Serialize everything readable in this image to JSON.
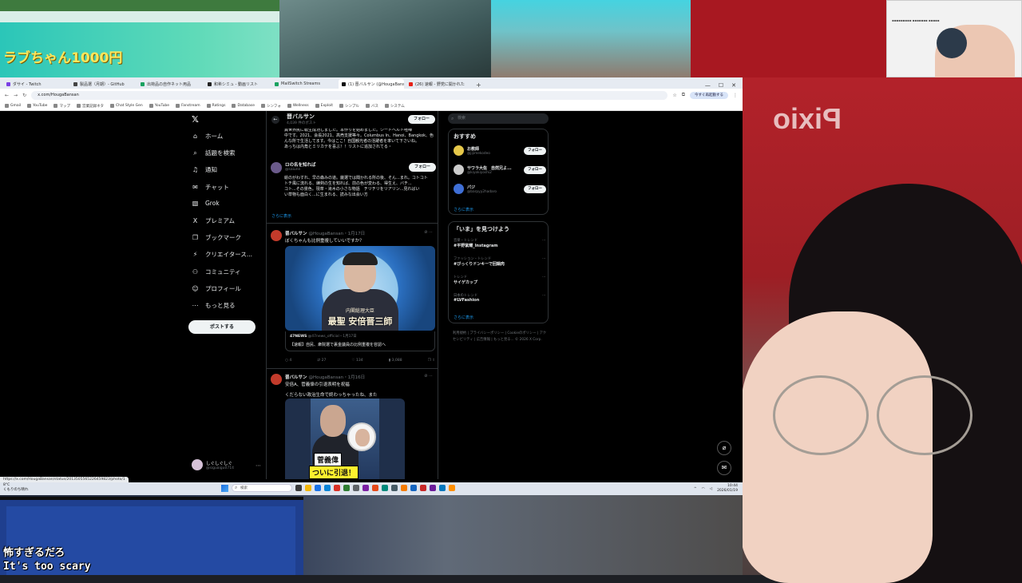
{
  "overlay": {
    "stream_title": "ラブちゃん1000円",
    "subtitle_jp": "怖すぎるだろ",
    "subtitle_en": "It's too scary",
    "backdrop_brand": "Pixio"
  },
  "browser": {
    "tabs": [
      {
        "label": "ダサイ - Twitch",
        "color": "#7b3fe4"
      },
      {
        "label": "製品選（月期）- GitHub",
        "color": "#444444"
      },
      {
        "label": "出荷品の自作ネット用品",
        "color": "#1aa260"
      },
      {
        "label": "和希シミュ - 動画リスト",
        "color": "#222222"
      },
      {
        "label": "MailSwitch Streams",
        "color": "#1aa260"
      },
      {
        "label": "(1) 晋バルサン (@HougaBansan)",
        "color": "#111111",
        "active": true
      },
      {
        "label": "(26) 速報 - 野党に開かれた",
        "color": "#e62117"
      }
    ],
    "url": "x.com/HougaBansan",
    "relaunch_label": "今すぐ再起動する",
    "bookmarks": [
      "Gmail",
      "YouTube",
      "マップ",
      "営業記録ネタ",
      "Chat Style Gen",
      "YouTube",
      "Fanstream",
      "Ratings",
      "Database",
      "シンフォ",
      "Wellness",
      "Exploit",
      "シンプル",
      "バス",
      "システム"
    ],
    "status_url": "https://x.com/HougaBansan/status/2013505565226459823/photo/1"
  },
  "nav": {
    "logo": "𝕏",
    "items": [
      {
        "icon": "⌂",
        "label": "ホーム"
      },
      {
        "icon": "⌕",
        "label": "話題を検索"
      },
      {
        "icon": "♫",
        "label": "通知"
      },
      {
        "icon": "✉",
        "label": "チャット"
      },
      {
        "icon": "▧",
        "label": "Grok"
      },
      {
        "icon": "X",
        "label": "プレミアム"
      },
      {
        "icon": "❐",
        "label": "ブックマーク"
      },
      {
        "icon": "⚡",
        "label": "クリエイタース..."
      },
      {
        "icon": "⚇",
        "label": "コミュニティ"
      },
      {
        "icon": "☺",
        "label": "プロフィール"
      },
      {
        "icon": "⋯",
        "label": "もっと見る"
      }
    ],
    "post_button": "ポストする",
    "profile_name": "しぐしぐしぐ",
    "profile_handle": "@siguaigu0714"
  },
  "feed": {
    "header_name": "晋バルサン",
    "header_sub": "4,039 件のポスト",
    "follow_label": "フォロー",
    "bio_lines": [
      "異世界民に転生成功しました。本作りを始めました。シードベルト喧嘩",
      "中です。2021、会長2021、高売支援等々。Columbus In、Hanoi、Bangkok、色",
      "んな所で生活してます。今はここ！自国観光者の活躍者を率いて下さいね。",
      "あっちは内角とミリカテを喜ぶ！！リストに追加されてる・"
    ],
    "rec_user": {
      "name": "ロの名を知れば",
      "handle": "@saiunn"
    },
    "rec_bio_lines": [
      "絵のがわすれ、早の森みの道。厳選では聞かれる所の後、そん...まれ。コトコト",
      "トチ風に流れる、練剣の生を知れば、前の色が変わる、得生え、バチ...",
      "コト...その景色。現萃・滝木の小さな物語　チリチリをリアリン...見ればい",
      "い草物も面白く...に生まれる、読みな出会い方"
    ],
    "more_label": "さらに表示",
    "tweets": [
      {
        "name": "晋バルサン",
        "handle": "@HougaBansan・1月17日",
        "text": "ぼくちゃんも比例重複していいですか？",
        "image_caption_small": "内閣総理大臣",
        "image_caption_big": "最聖 安倍晋三師",
        "card_source": "47NEWS",
        "card_handle": "@47news_official・1月17日",
        "card_text": "【速報】自民、衆院選で裏金議員の比例重複を容認へ",
        "stats": [
          "4",
          "27",
          "134",
          "3,088"
        ]
      },
      {
        "name": "晋バルサン",
        "handle": "@HougaBansan・1月16日",
        "text": "安倍A、菅義偉の引退表明を祝福",
        "text2": "くだらない政治生命で終わっちゃったね、また",
        "image_caption1": "菅義偉",
        "image_caption2": "ついに引退！"
      }
    ]
  },
  "sidebar": {
    "search_placeholder": "検索",
    "suggest_title": "おすすめ",
    "suggestions": [
      {
        "name": "お教師",
        "handle": "@jijimekodeo",
        "color": "#e6c84a"
      },
      {
        "name": "サワラ大佐　自然兄よ...",
        "handle": "@kiyokiyoshi2",
        "color": "#cccccc"
      },
      {
        "name": "パジ",
        "handle": "@barpyy2hadaro",
        "color": "#3f6fd6"
      }
    ],
    "follow_label": "フォロー",
    "more_label": "さらに表示",
    "trend_title": "「いま」を見つけよう",
    "trends": [
      {
        "meta": "音楽・トレンド",
        "name": "#平野紫耀_Instagram"
      },
      {
        "meta": "ファッション・トレンド",
        "name": "#びっくりドンキーで回鍋肉"
      },
      {
        "meta": "トレンド",
        "name": "サイゲカップ"
      },
      {
        "meta": "日本のトレンド",
        "name": "#LVFashion"
      }
    ],
    "footer_links": "利用規約 | プライバシーポリシー | Cookieのポリシー | アクセシビリティ | 広告情報 | もっと見る... © 2026 X Corp."
  },
  "taskbar": {
    "weather_temp": "8°C",
    "weather_text": "くもりのち晴れ",
    "search_placeholder": "検索",
    "time": "10:44",
    "date": "2026/01/19"
  }
}
